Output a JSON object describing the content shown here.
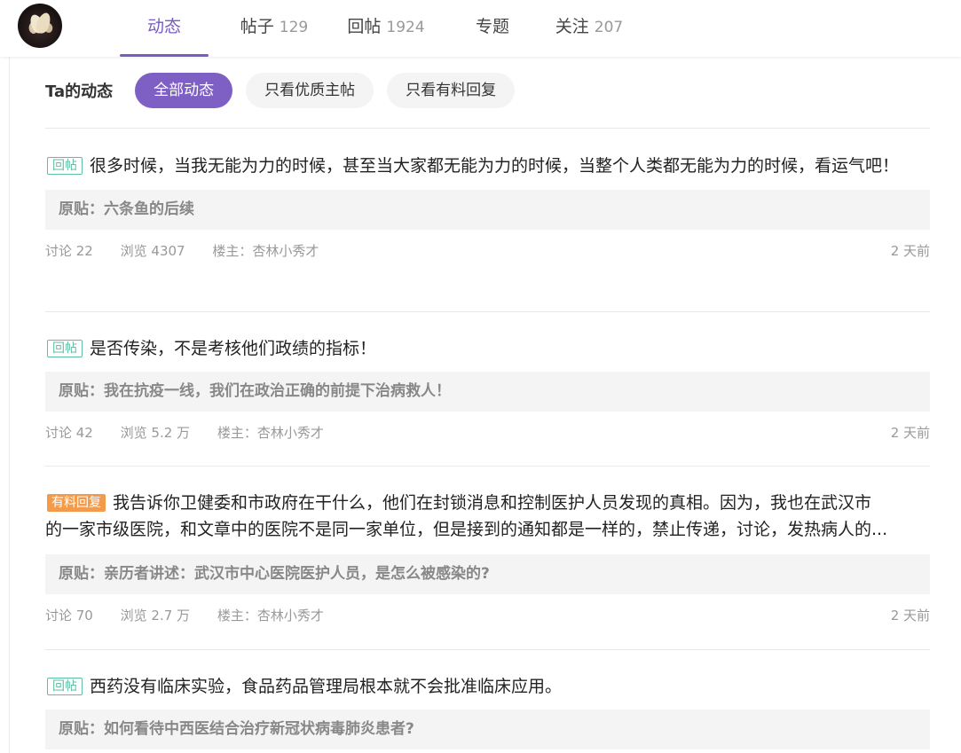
{
  "nav": {
    "tabs": [
      {
        "label": "动态",
        "count": ""
      },
      {
        "label": "帖子",
        "count": "129"
      },
      {
        "label": "回帖",
        "count": "1924"
      },
      {
        "label": "专题",
        "count": ""
      },
      {
        "label": "关注",
        "count": "207"
      }
    ],
    "active_color": "#7a5bbf"
  },
  "filter": {
    "title": "Ta的动态",
    "options": [
      "全部动态",
      "只看优质主帖",
      "只看有料回复"
    ],
    "selected": "全部动态"
  },
  "feed": [
    {
      "tag": "回帖",
      "text": "很多时候，当我无能为力的时候，甚至当大家都无能为力的时候，当整个人类都无能为力的时候，看运气吧！",
      "origin": "原贴：六条鱼的后续",
      "discuss": "讨论 22",
      "views": "浏览 4307",
      "owner": "楼主：杏林小秀才",
      "time": "2 天前"
    },
    {
      "tag": "回帖",
      "text": "是否传染，不是考核他们政绩的指标！",
      "origin": "原贴：我在抗疫一线，我们在政治正确的前提下治病救人！",
      "discuss": "讨论 42",
      "views": "浏览 5.2 万",
      "owner": "楼主：杏林小秀才",
      "time": "2 天前"
    },
    {
      "tag": "有料回复",
      "text_line1": "我告诉你卫健委和市政府在干什么，他们在封锁消息和控制医护人员发现的真相。因为，我也在武汉市",
      "text_line2": "的一家市级医院，和文章中的医院不是同一家单位，但是接到的通知都是一样的，禁止传递，讨论，发热病人的...",
      "origin": "原贴：亲历者讲述：武汉市中心医院医护人员，是怎么被感染的?",
      "discuss": "讨论 70",
      "views": "浏览 2.7 万",
      "owner": "楼主：杏林小秀才",
      "time": "2 天前"
    },
    {
      "tag": "回帖",
      "text": "西药没有临床实验，食品药品管理局根本就不会批准临床应用。",
      "origin": "原贴：如何看待中西医结合治疗新冠状病毒肺炎患者?"
    }
  ],
  "colors": {
    "reply_tag": "#5fbfa4",
    "quality_tag": "#f29b4c",
    "pill_active": "#7e5fc4"
  },
  "icons": {
    "avatar": "magnolia-flower-avatar"
  }
}
